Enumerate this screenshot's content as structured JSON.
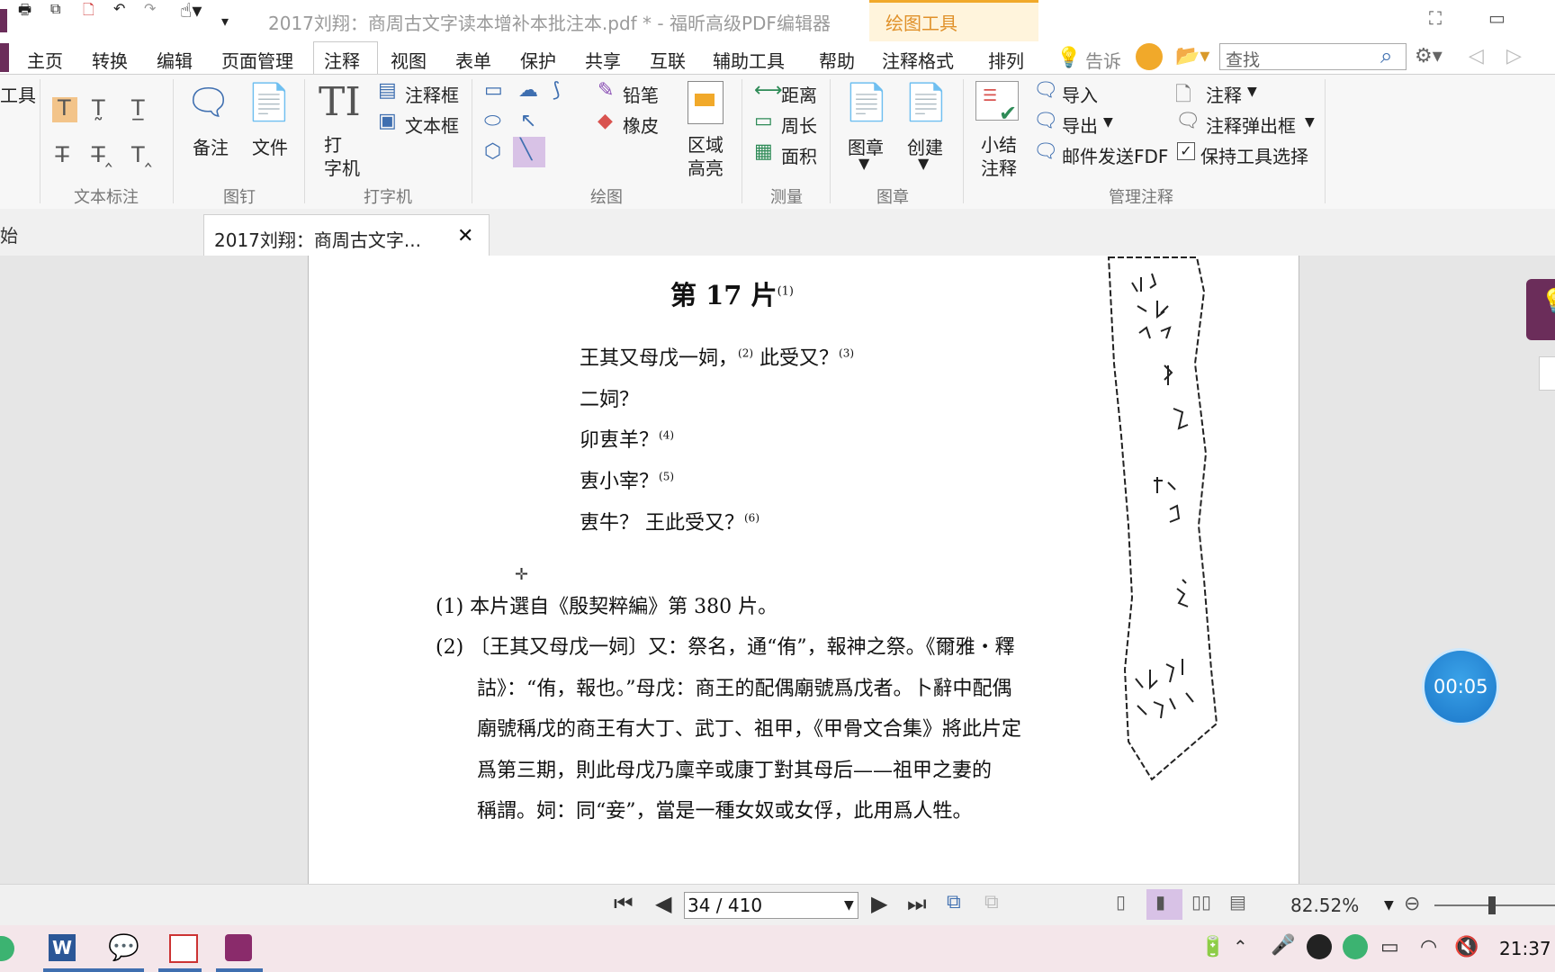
{
  "window": {
    "title": "2017刘翔：商周古文字读本增补本批注本.pdf * - 福昕高级PDF编辑器",
    "context_tab": "绘图工具"
  },
  "menu": [
    "主页",
    "转换",
    "编辑",
    "页面管理",
    "注释",
    "视图",
    "表单",
    "保护",
    "共享",
    "互联",
    "辅助工具",
    "帮助",
    "注释格式",
    "排列"
  ],
  "tell_me": "告诉",
  "search": {
    "placeholder": "查找"
  },
  "ribbon": {
    "left_partial": "工具",
    "text_markup_label": "文本标注",
    "pin": {
      "note": "备注",
      "file": "文件",
      "label": "图钉"
    },
    "typewriter": {
      "typewriter": "打\n字机",
      "callout": "注释框",
      "textbox": "文本框",
      "label": "打字机"
    },
    "drawing": {
      "pencil": "铅笔",
      "eraser": "橡皮",
      "area_highlight": "区域\n高亮",
      "label": "绘图"
    },
    "measure": {
      "distance": "距离",
      "perimeter": "周长",
      "area": "面积",
      "label": "测量"
    },
    "stamp": {
      "stamp": "图章",
      "create": "创建",
      "label": "图章"
    },
    "manage": {
      "summarize": "小结\n注释",
      "import": "导入",
      "export": "导出",
      "email_fdf": "邮件发送FDF",
      "comments": "注释",
      "popup": "注释弹出框",
      "keep_tool": "保持工具选择",
      "label": "管理注释"
    }
  },
  "tabs": {
    "start": "始",
    "doc": "2017刘翔：商周古文字..."
  },
  "pdf": {
    "heading": "第 17 片",
    "heading_sup": "(1)",
    "verses": [
      {
        "text": "王其又母戊一㚸，",
        "sup": "(2)",
        "text2": " 此受又？",
        "sup2": "(3)"
      },
      {
        "text": "二㚸？",
        "sup": "",
        "text2": "",
        "sup2": ""
      },
      {
        "text": "卯叀羊？",
        "sup": "(4)",
        "text2": "",
        "sup2": ""
      },
      {
        "text": "叀小宰？",
        "sup": "(5)",
        "text2": "",
        "sup2": ""
      },
      {
        "text": "叀牛？ 王此受又？",
        "sup": "(6)",
        "text2": "",
        "sup2": ""
      }
    ],
    "notes": [
      "(1) 本片選自《殷契粹編》第 380 片。",
      "(2) 〔王其又母戊一㚸〕又：祭名，通“侑”，報神之祭。《爾雅・釋",
      "詁》：“侑，報也。”母戊：商王的配偶廟號爲戊者。卜辭中配偶",
      "廟號稱戊的商王有大丁、武丁、祖甲，《甲骨文合集》將此片定",
      "爲第三期，則此母戊乃廩辛或康丁對其母后——祖甲之妻的",
      "稱謂。㚸：同“妾”，當是一種女奴或女俘，此用爲人牲。"
    ]
  },
  "timer": "00:05",
  "status": {
    "page": "34 / 410",
    "zoom": "82.52%"
  },
  "clock": "21:37",
  "colors": {
    "accent": "#3f6fb0",
    "context_tab": "#e0912a",
    "purple": "#6b2d5a"
  }
}
